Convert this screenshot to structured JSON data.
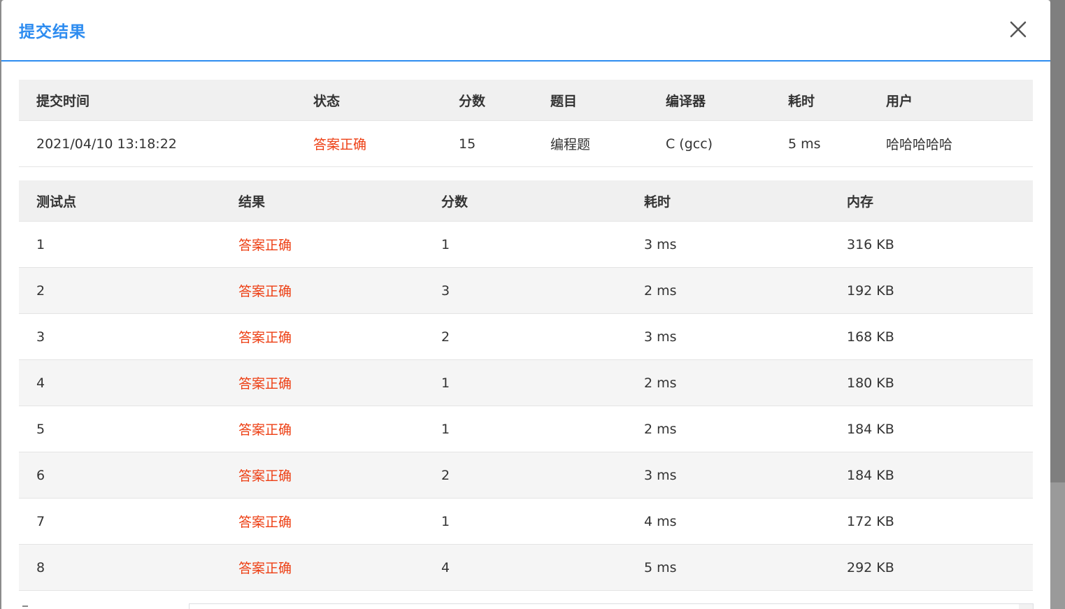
{
  "dialog": {
    "title": "提交结果"
  },
  "summary": {
    "headers": [
      "提交时间",
      "状态",
      "分数",
      "题目",
      "编译器",
      "耗时",
      "用户"
    ],
    "row": {
      "time": "2021/04/10 13:18:22",
      "status": "答案正确",
      "score": "15",
      "problem": "编程题",
      "compiler": "C (gcc)",
      "duration": "5 ms",
      "user": "哈哈哈哈哈"
    }
  },
  "tests": {
    "headers": [
      "测试点",
      "结果",
      "分数",
      "耗时",
      "内存"
    ],
    "rows": [
      {
        "id": "1",
        "result": "答案正确",
        "score": "1",
        "time": "3 ms",
        "memory": "316 KB"
      },
      {
        "id": "2",
        "result": "答案正确",
        "score": "3",
        "time": "2 ms",
        "memory": "192 KB"
      },
      {
        "id": "3",
        "result": "答案正确",
        "score": "2",
        "time": "3 ms",
        "memory": "168 KB"
      },
      {
        "id": "4",
        "result": "答案正确",
        "score": "1",
        "time": "2 ms",
        "memory": "180 KB"
      },
      {
        "id": "5",
        "result": "答案正确",
        "score": "1",
        "time": "2 ms",
        "memory": "184 KB"
      },
      {
        "id": "6",
        "result": "答案正确",
        "score": "2",
        "time": "3 ms",
        "memory": "184 KB"
      },
      {
        "id": "7",
        "result": "答案正确",
        "score": "1",
        "time": "4 ms",
        "memory": "172 KB"
      },
      {
        "id": "8",
        "result": "答案正确",
        "score": "4",
        "time": "5 ms",
        "memory": "292 KB"
      }
    ]
  },
  "colors": {
    "accent": "#2d8cf0",
    "success_text": "#ed3f14",
    "header_bg": "#f0f0f0",
    "stripe_bg": "#f5f5f5"
  },
  "icons": {
    "close": "close-icon"
  }
}
